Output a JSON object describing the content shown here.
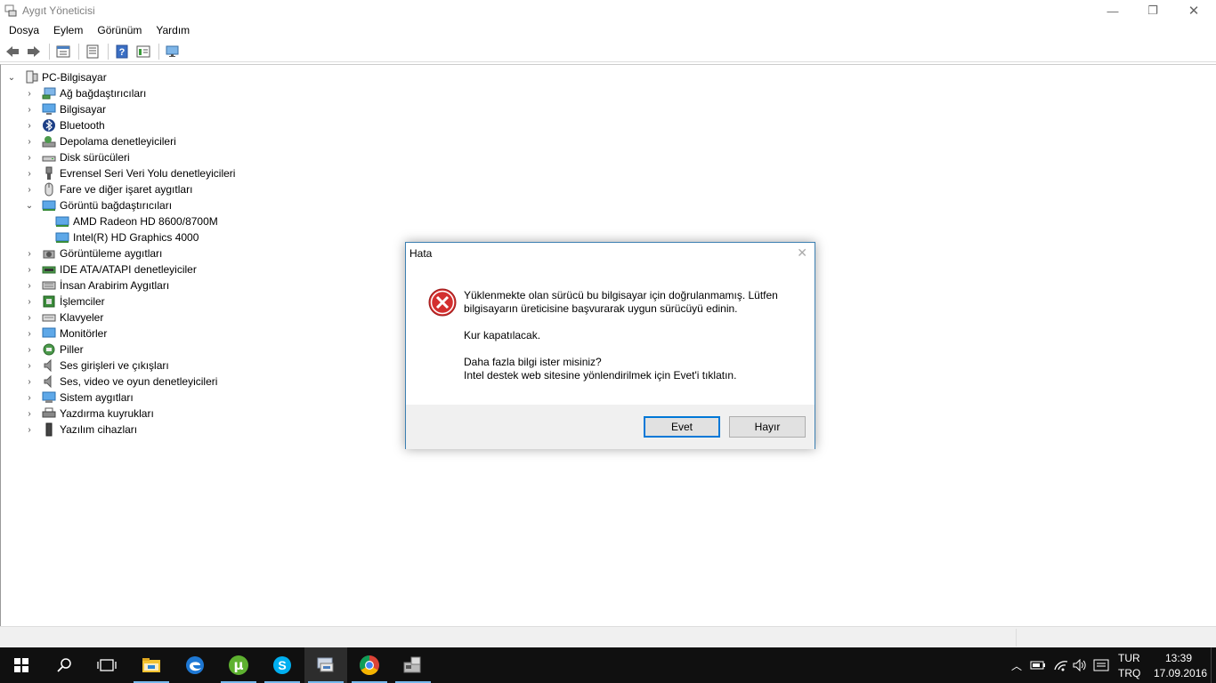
{
  "window": {
    "title": "Aygıt Yöneticisi",
    "controls": {
      "minimize": "—",
      "restore": "❐",
      "close": "✕"
    }
  },
  "menubar": [
    "Dosya",
    "Eylem",
    "Görünüm",
    "Yardım"
  ],
  "toolbar": {
    "buttons": [
      "back-icon",
      "forward-icon",
      "properties-icon",
      "view-icon",
      "help-icon",
      "list-icon",
      "monitor-scan-icon"
    ]
  },
  "tree": {
    "root": "PC-Bilgisayar",
    "items": [
      {
        "label": "Ağ bağdaştırıcıları",
        "icon": "network-adapter-icon",
        "expanded": false
      },
      {
        "label": "Bilgisayar",
        "icon": "computer-icon",
        "expanded": false
      },
      {
        "label": "Bluetooth",
        "icon": "bluetooth-icon",
        "expanded": false
      },
      {
        "label": "Depolama denetleyicileri",
        "icon": "storage-controller-icon",
        "expanded": false
      },
      {
        "label": "Disk sürücüleri",
        "icon": "disk-drive-icon",
        "expanded": false
      },
      {
        "label": "Evrensel Seri Veri Yolu denetleyicileri",
        "icon": "usb-icon",
        "expanded": false
      },
      {
        "label": "Fare ve diğer işaret aygıtları",
        "icon": "mouse-icon",
        "expanded": false
      },
      {
        "label": "Görüntü bağdaştırıcıları",
        "icon": "display-adapter-icon",
        "expanded": true,
        "children": [
          {
            "label": "AMD Radeon HD 8600/8700M",
            "icon": "display-adapter-icon"
          },
          {
            "label": "Intel(R) HD Graphics 4000",
            "icon": "display-adapter-icon"
          }
        ]
      },
      {
        "label": "Görüntüleme aygıtları",
        "icon": "imaging-device-icon",
        "expanded": false
      },
      {
        "label": "IDE ATA/ATAPI denetleyiciler",
        "icon": "ide-controller-icon",
        "expanded": false
      },
      {
        "label": "İnsan Arabirim Aygıtları",
        "icon": "hid-icon",
        "expanded": false
      },
      {
        "label": "İşlemciler",
        "icon": "processor-icon",
        "expanded": false
      },
      {
        "label": "Klavyeler",
        "icon": "keyboard-icon",
        "expanded": false
      },
      {
        "label": "Monitörler",
        "icon": "monitor-icon",
        "expanded": false
      },
      {
        "label": "Piller",
        "icon": "battery-icon",
        "expanded": false
      },
      {
        "label": "Ses girişleri ve çıkışları",
        "icon": "audio-io-icon",
        "expanded": false
      },
      {
        "label": "Ses, video ve oyun denetleyicileri",
        "icon": "sound-controller-icon",
        "expanded": false
      },
      {
        "label": "Sistem aygıtları",
        "icon": "system-device-icon",
        "expanded": false
      },
      {
        "label": "Yazdırma kuyrukları",
        "icon": "printer-icon",
        "expanded": false
      },
      {
        "label": "Yazılım cihazları",
        "icon": "software-device-icon",
        "expanded": false
      }
    ]
  },
  "dialog": {
    "title": "Hata",
    "close": "✕",
    "message1": "Yüklenmekte olan sürücü bu bilgisayar için doğrulanmamış. Lütfen",
    "message2": "bilgisayarın üreticisine başvurarak uygun sürücüyü edinin.",
    "message3": "Kur kapatılacak.",
    "message4": "Daha fazla bilgi ister misiniz?",
    "message5": "Intel destek web sitesine yönlendirilmek için Evet'i tıklatın.",
    "yes_label": "Evet",
    "no_label": "Hayır"
  },
  "taskbar": {
    "apps": [
      "start-icon",
      "search-icon",
      "task-view-icon",
      "file-explorer-icon",
      "edge-icon",
      "utorrent-icon",
      "skype-icon",
      "device-manager-icon",
      "chrome-icon",
      "installer-icon"
    ],
    "active_index": 7,
    "language_top": "TUR",
    "language_bottom": "TRQ",
    "time": "13:39",
    "date": "17.09.2016"
  },
  "colors": {
    "accent": "#0078d7",
    "taskbar": "#101010",
    "error_red": "#d32f2f"
  }
}
